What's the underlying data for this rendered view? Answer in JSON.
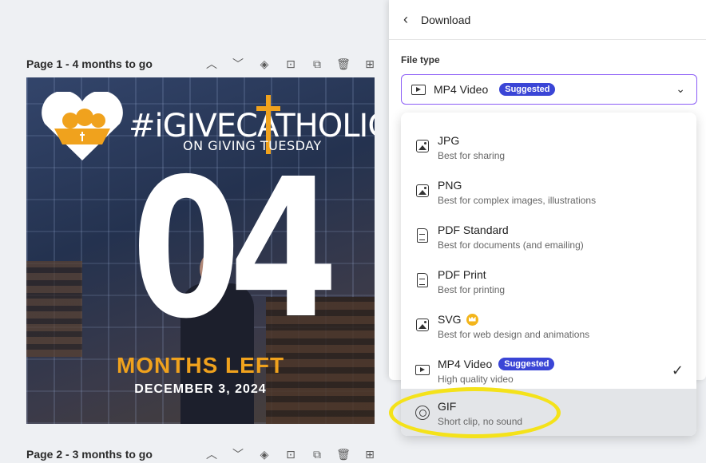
{
  "pages": [
    {
      "title": "Page 1 - 4 months to go",
      "design": {
        "brand": "#iGIVECATHOLIC",
        "brand_sub": "ON GIVING TUESDAY",
        "number": "04",
        "headline": "MONTHS LEFT",
        "date": "DECEMBER 3, 2024"
      }
    },
    {
      "title": "Page 2 - 3 months to go"
    }
  ],
  "page_tools": [
    "chevron-up",
    "chevron-down",
    "hide",
    "lock",
    "duplicate",
    "delete",
    "add-page"
  ],
  "panel": {
    "title": "Download",
    "file_type_label": "File type",
    "selected": {
      "label": "MP4 Video",
      "badge": "Suggested"
    }
  },
  "options": [
    {
      "name": "JPG",
      "desc": "Best for sharing",
      "icon": "image-icon"
    },
    {
      "name": "PNG",
      "desc": "Best for complex images, illustrations",
      "icon": "image-icon"
    },
    {
      "name": "PDF Standard",
      "desc": "Best for documents (and emailing)",
      "icon": "document-icon"
    },
    {
      "name": "PDF Print",
      "desc": "Best for printing",
      "icon": "document-icon"
    },
    {
      "name": "SVG",
      "desc": "Best for web design and animations",
      "icon": "image-icon",
      "pro": true
    },
    {
      "name": "MP4 Video",
      "desc": "High quality video",
      "icon": "video-icon",
      "badge": "Suggested",
      "checked": true
    },
    {
      "name": "GIF",
      "desc": "Short clip, no sound",
      "icon": "gif-icon",
      "hovered": true
    }
  ],
  "colors": {
    "accent_border": "#8b5cf6",
    "badge": "#3a45d6",
    "brand_orange": "#f0a21d",
    "highlight_ring": "#f4e21a"
  }
}
